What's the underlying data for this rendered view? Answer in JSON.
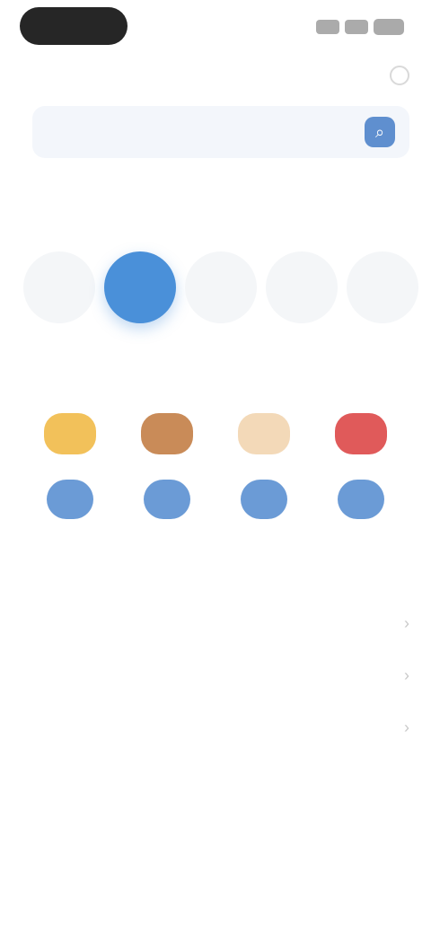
{
  "status_bar": {
    "time": "",
    "signal_icon": "signal-icon",
    "wifi_icon": "wifi-icon",
    "battery_icon": "battery-icon"
  },
  "header": {
    "title": "",
    "right_icon": "info-icon"
  },
  "search": {
    "placeholder": "",
    "button_icon": "search-icon"
  },
  "categories_section": {
    "title": "",
    "link": "",
    "items": [
      {
        "label": "",
        "state": "faded"
      },
      {
        "label": "",
        "state": "active"
      },
      {
        "label": "",
        "state": "faded"
      },
      {
        "label": "",
        "state": "faded"
      },
      {
        "label": "",
        "state": "faded"
      }
    ]
  },
  "prizes_section": {
    "title": "",
    "link": "",
    "items": [
      {
        "image_color": "#f2c15a",
        "button_label": ""
      },
      {
        "image_color": "#c98b58",
        "button_label": ""
      },
      {
        "image_color": "#f3d9b8",
        "button_label": ""
      },
      {
        "image_color": "#e05a5a",
        "button_label": ""
      }
    ]
  },
  "promotions_section": {
    "title": "",
    "items": [
      {
        "text": ""
      },
      {
        "text": ""
      },
      {
        "text": ""
      }
    ]
  },
  "colors": {
    "accent": "#4a90d9",
    "button": "#6b9bd6",
    "promo_text": "#6aa86a",
    "search_bg": "#f3f6fb"
  }
}
